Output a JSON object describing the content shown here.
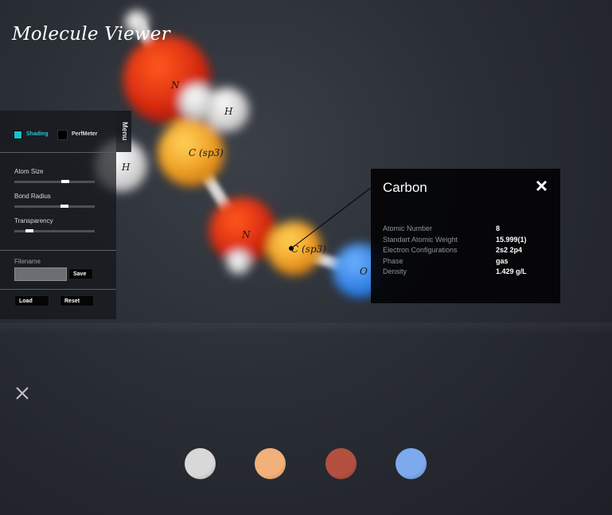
{
  "app": {
    "title": "Molecule Viewer"
  },
  "molecule": {
    "atoms": [
      {
        "label": "N",
        "element": "nitrogen",
        "color": "#e33b14"
      },
      {
        "label": "H",
        "element": "hydrogen",
        "color": "#e6e6e6"
      },
      {
        "label": "C (sp3)",
        "element": "carbon",
        "color": "#f4a53a"
      },
      {
        "label": "H",
        "element": "hydrogen",
        "color": "#e6e6e6"
      },
      {
        "label": "N",
        "element": "nitrogen",
        "color": "#e33b14"
      },
      {
        "label": "C (sp3)",
        "element": "carbon",
        "color": "#f4a53a"
      },
      {
        "label": "O",
        "element": "oxygen",
        "color": "#3f8df0"
      }
    ],
    "selected_atom": "C (sp3)"
  },
  "panel": {
    "menu_label": "Menu",
    "toggles": [
      {
        "label": "Shading",
        "checked": true,
        "color": "#19c1c9"
      },
      {
        "label": "PerfMeter",
        "checked": false
      }
    ],
    "sliders": [
      {
        "label": "Atom Size",
        "value": 0.65
      },
      {
        "label": "Bond Radius",
        "value": 0.64
      },
      {
        "label": "Transparency",
        "value": 0.15
      }
    ],
    "file": {
      "label": "Filename",
      "value": "",
      "save": "Save",
      "load": "Load",
      "reset": "Reset"
    }
  },
  "info": {
    "title": "Carbon",
    "close_icon": "close-icon",
    "properties": [
      {
        "name": "Atomic Number",
        "value": "8"
      },
      {
        "name": "Standart Atomic Weight",
        "value": "15.999(1)"
      },
      {
        "name": "Electron Configurations",
        "value": "2s2 2p4"
      },
      {
        "name": "Phase",
        "value": "gas"
      },
      {
        "name": "Density",
        "value": "1.429 g/L"
      }
    ]
  },
  "palette": {
    "swatches": [
      {
        "element": "hydrogen",
        "color": "#d8d8d8"
      },
      {
        "element": "carbon",
        "color": "#f2b07a"
      },
      {
        "element": "nitrogen",
        "color": "#b3503f"
      },
      {
        "element": "oxygen",
        "color": "#7da9ef"
      }
    ]
  }
}
